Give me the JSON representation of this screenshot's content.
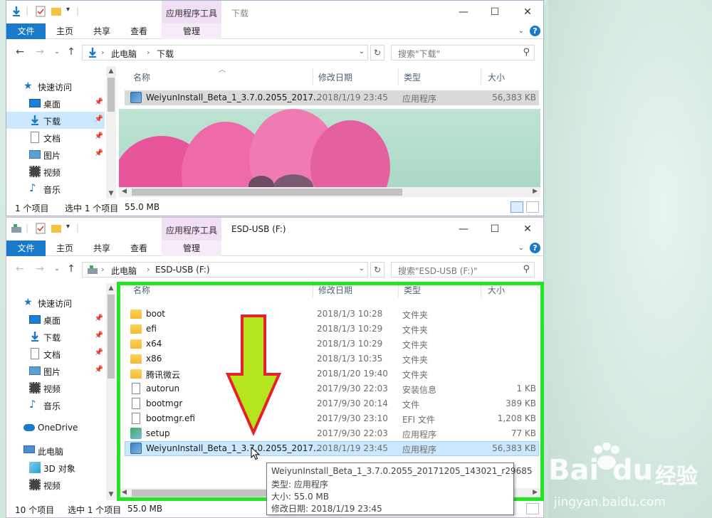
{
  "window_top": {
    "title": "下载",
    "tool_tab": "应用程序工具",
    "ribbon_tabs": [
      "文件",
      "主页",
      "共享",
      "查看",
      "管理"
    ],
    "address_path": [
      "此电脑",
      "下载"
    ],
    "search_placeholder": "搜索\"下载\"",
    "nav_items": [
      {
        "label": "快速访问",
        "icon": "star-icon"
      },
      {
        "label": "桌面",
        "icon": "desktop-icon"
      },
      {
        "label": "下载",
        "icon": "download-icon"
      },
      {
        "label": "文档",
        "icon": "document-icon"
      },
      {
        "label": "图片",
        "icon": "pictures-icon"
      },
      {
        "label": "视频",
        "icon": "video-icon"
      },
      {
        "label": "音乐",
        "icon": "music-icon"
      }
    ],
    "columns": [
      "名称",
      "修改日期",
      "类型",
      "大小"
    ],
    "files": [
      {
        "name": "WeiyunInstall_Beta_1_3.7.0.2055_2017...",
        "date": "2018/1/19 23:45",
        "type": "应用程序",
        "size": "56,383 KB",
        "icon": "app-icon"
      }
    ],
    "status": {
      "count": "1 个项目",
      "selected": "选中 1 个项目",
      "size": "55.0 MB"
    }
  },
  "window_bottom": {
    "title": "ESD-USB (F:)",
    "tool_tab": "应用程序工具",
    "ribbon_tabs": [
      "文件",
      "主页",
      "共享",
      "查看",
      "管理"
    ],
    "address_path": [
      "此电脑",
      "ESD-USB (F:)"
    ],
    "search_placeholder": "搜索\"ESD-USB (F:)\"",
    "nav_items": [
      {
        "label": "快速访问",
        "icon": "star-icon"
      },
      {
        "label": "桌面",
        "icon": "desktop-icon"
      },
      {
        "label": "下载",
        "icon": "download-icon"
      },
      {
        "label": "文档",
        "icon": "document-icon"
      },
      {
        "label": "图片",
        "icon": "pictures-icon"
      },
      {
        "label": "视频",
        "icon": "video-icon"
      },
      {
        "label": "音乐",
        "icon": "music-icon"
      },
      {
        "label": "OneDrive",
        "icon": "cloud-icon"
      },
      {
        "label": "此电脑",
        "icon": "computer-icon"
      },
      {
        "label": "3D 对象",
        "icon": "cube-icon"
      },
      {
        "label": "视频",
        "icon": "video-icon"
      }
    ],
    "columns": [
      "名称",
      "修改日期",
      "类型",
      "大小"
    ],
    "files": [
      {
        "name": "boot",
        "date": "2018/1/3 10:28",
        "type": "文件夹",
        "size": "",
        "icon": "folder-icon"
      },
      {
        "name": "efi",
        "date": "2018/1/3 10:29",
        "type": "文件夹",
        "size": "",
        "icon": "folder-icon"
      },
      {
        "name": "x64",
        "date": "2018/1/3 10:29",
        "type": "文件夹",
        "size": "",
        "icon": "folder-icon"
      },
      {
        "name": "x86",
        "date": "2018/1/3 10:35",
        "type": "文件夹",
        "size": "",
        "icon": "folder-icon"
      },
      {
        "name": "腾讯微云",
        "date": "2018/1/20 19:40",
        "type": "文件夹",
        "size": "",
        "icon": "folder-icon"
      },
      {
        "name": "autorun",
        "date": "2017/9/30 22:03",
        "type": "安装信息",
        "size": "1 KB",
        "icon": "settings-file-icon"
      },
      {
        "name": "bootmgr",
        "date": "2017/9/30 20:14",
        "type": "文件",
        "size": "389 KB",
        "icon": "file-icon"
      },
      {
        "name": "bootmgr.efi",
        "date": "2017/9/30 23:10",
        "type": "EFI 文件",
        "size": "1,208 KB",
        "icon": "file-icon"
      },
      {
        "name": "setup",
        "date": "2017/9/30 22:03",
        "type": "应用程序",
        "size": "77 KB",
        "icon": "setup-icon"
      },
      {
        "name": "WeiyunInstall_Beta_1_3.7.0.2055_2017...",
        "date": "2018/1/19 23:45",
        "type": "应用程序",
        "size": "56,383 KB",
        "icon": "app-icon"
      }
    ],
    "status": {
      "count": "10 个项目",
      "selected": "选中 1 个项目",
      "size": "55.0 MB"
    },
    "tooltip": {
      "line1": "WeiyunInstall_Beta_1_3.7.0.2055_20171205_143021_r29685",
      "line2": "类型: 应用程序",
      "line3": "大小: 55.0 MB",
      "line4": "修改日期: 2018/1/19 23:45"
    }
  },
  "watermark": {
    "brand": "Bai",
    "brand2": "du",
    "cn": "经验",
    "url": "jingyan.baidu.com"
  },
  "colors": {
    "accent": "#1979ca",
    "selection": "#cce8ff",
    "highlight": "#22e622",
    "arrow_fill": "#b5e61d",
    "arrow_stroke": "#e8202a"
  }
}
